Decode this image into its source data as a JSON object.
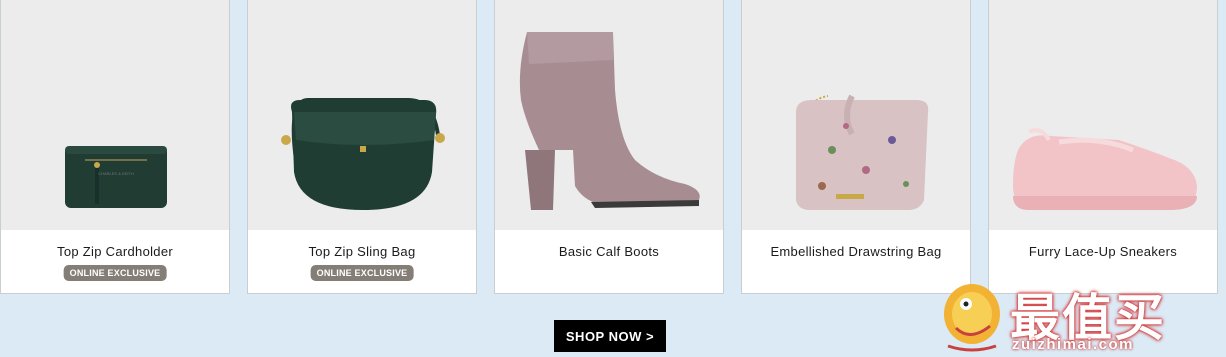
{
  "products": [
    {
      "name": "Top Zip Cardholder",
      "badge": "ONLINE EXCLUSIVE",
      "icon": "cardholder-image"
    },
    {
      "name": "Top Zip Sling Bag",
      "badge": "ONLINE EXCLUSIVE",
      "icon": "sling-bag-image"
    },
    {
      "name": "Basic Calf Boots",
      "badge": "",
      "icon": "boot-image"
    },
    {
      "name": "Embellished Drawstring Bag",
      "badge": "",
      "icon": "drawstring-bag-image"
    },
    {
      "name": "Furry Lace-Up Sneakers",
      "badge": "",
      "icon": "sneaker-image"
    }
  ],
  "cta": {
    "label": "SHOP NOW >"
  },
  "watermark": {
    "chinese": "最值买",
    "url": "zuizhimai.com"
  },
  "colors": {
    "background": "#dceaf6",
    "badge": "#857e76",
    "button": "#000000"
  }
}
